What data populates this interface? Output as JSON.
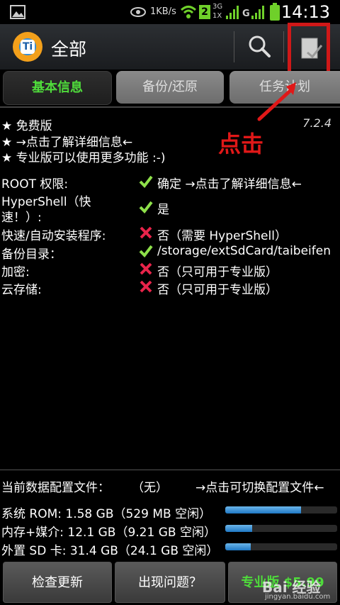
{
  "status_bar": {
    "speed": "1KB/s",
    "sim_badge": "2",
    "net_3g": "3G",
    "net_1x": "1X",
    "net_g": "G",
    "time": "14:13"
  },
  "action_bar": {
    "logo_letter": "Ti",
    "title": "全部"
  },
  "tabs": [
    {
      "label": "基本信息"
    },
    {
      "label": "备份/还原"
    },
    {
      "label": "任务计划"
    }
  ],
  "info": {
    "lines": [
      "★ 免费版",
      "★ →点击了解详细信息←",
      "★ 专业版可以使用更多功能 :-)"
    ],
    "version": "7.2.4"
  },
  "annotation": {
    "text": "点击",
    "color": "#e01818"
  },
  "rows": [
    {
      "label": "ROOT 权限:",
      "status": "ok",
      "value": "确定 →点击了解详细信息←"
    },
    {
      "label": "HyperShell（快",
      "label2": "速！）:",
      "status": "ok",
      "value": "是"
    },
    {
      "label": "快速/自动安装程序:",
      "status": "no",
      "value": "否（需要 HyperShell）"
    },
    {
      "label": "备份目录：",
      "status": "ok",
      "value": "/storage/extSdCard/taibeifen"
    },
    {
      "label": "加密:",
      "status": "no",
      "value": "否（只可用于专业版）"
    },
    {
      "label": "云存储:",
      "status": "no",
      "value": "否（只可用于专业版）"
    }
  ],
  "profile": {
    "label": "当前数据配置文件：",
    "value": "（无）",
    "action": "→点击可切换配置文件←"
  },
  "storage": [
    {
      "label": "系统 ROM: 1.58 GB（529 MB 空闲）",
      "used_fraction": 0.68
    },
    {
      "label": "内存+媒介: 12.1 GB（9.21 GB 空闲）",
      "used_fraction": 0.24
    },
    {
      "label": "外置 SD 卡: 31.4 GB（24.1 GB 空闲）",
      "used_fraction": 0.23
    }
  ],
  "buttons": {
    "check_update": "检查更新",
    "problem": "出现问题？",
    "pro": "专业版 $5.99"
  },
  "watermark": {
    "main": "Bai 经验",
    "sub": "jingyan.baidu.com"
  },
  "colors": {
    "accent_green": "#4fdc3b",
    "ok_green": "#8ee04a",
    "no_red": "#e8244a",
    "progress_blue": "#1f78c4"
  }
}
